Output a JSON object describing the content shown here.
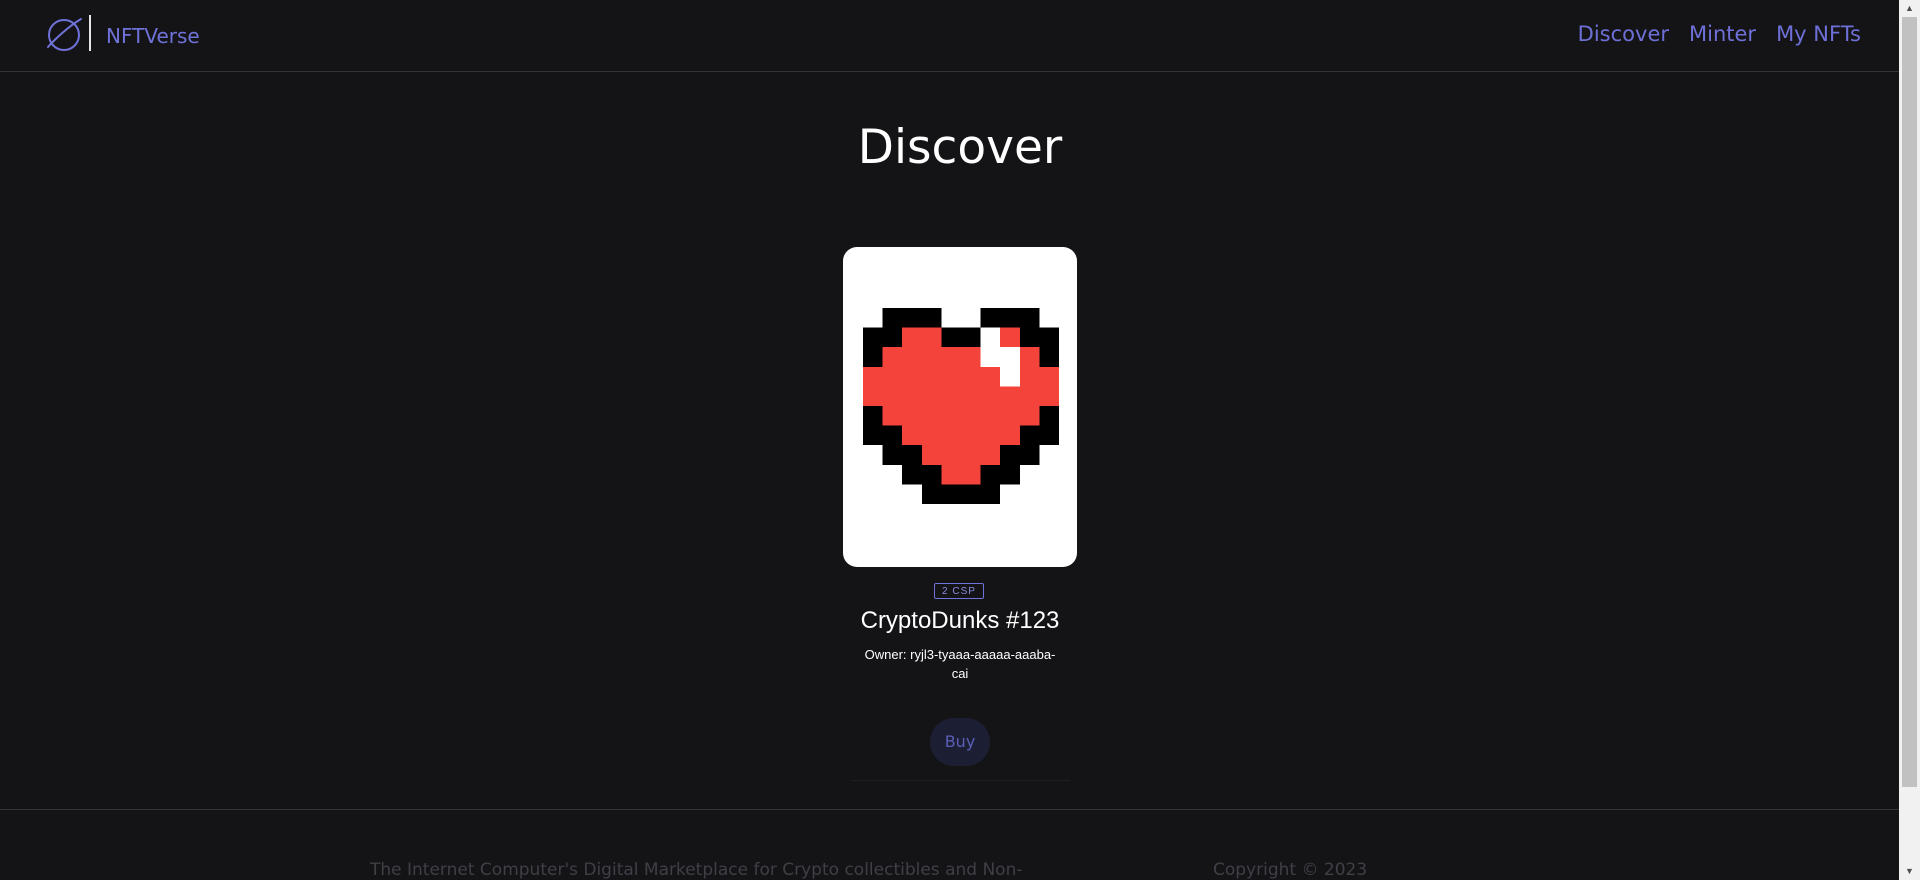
{
  "header": {
    "brand": "NFTVerse",
    "nav": [
      "Discover",
      "Minter",
      "My NFTs"
    ]
  },
  "page_title": "Discover",
  "nft": {
    "price": "2 CSP",
    "name": "CryptoDunks #123",
    "owner": "Owner: ryjl3-tyaaa-aaaaa-aaaba-cai",
    "buy_label": "Buy"
  },
  "footer": {
    "description": "The Internet Computer's Digital Marketplace for Crypto collectibles and Non-",
    "copyright": "Copyright © 2023"
  },
  "colors": {
    "background": "#141417",
    "accent": "#6f72d8",
    "heart_red": "#f4433a"
  }
}
